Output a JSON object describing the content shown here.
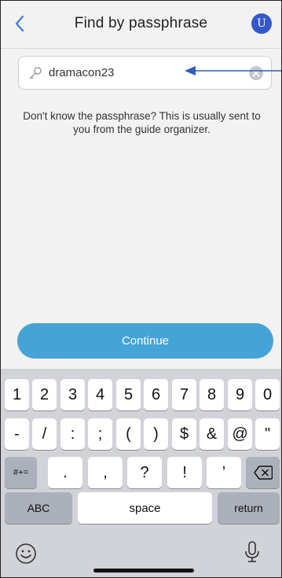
{
  "header": {
    "title": "Find by passphrase",
    "avatar_initial": "U"
  },
  "search": {
    "value": "dramacon23"
  },
  "help_text": "Don't know the passphrase? This is usually sent to you from the guide organizer.",
  "continue_label": "Continue",
  "colors": {
    "accent": "#45a3d8",
    "avatar": "#3657c8",
    "annotation_arrow": "#2f5db8"
  },
  "keyboard": {
    "row1": [
      "1",
      "2",
      "3",
      "4",
      "5",
      "6",
      "7",
      "8",
      "9",
      "0"
    ],
    "row2": [
      "-",
      "/",
      ":",
      ";",
      "(",
      ")",
      "$",
      "&",
      "@",
      "\""
    ],
    "row3": {
      "toggle": "#+=",
      "keys": [
        ".",
        ",",
        "?",
        "!",
        "’"
      ]
    },
    "row4": {
      "abc": "ABC",
      "space": "space",
      "return": "return"
    }
  }
}
